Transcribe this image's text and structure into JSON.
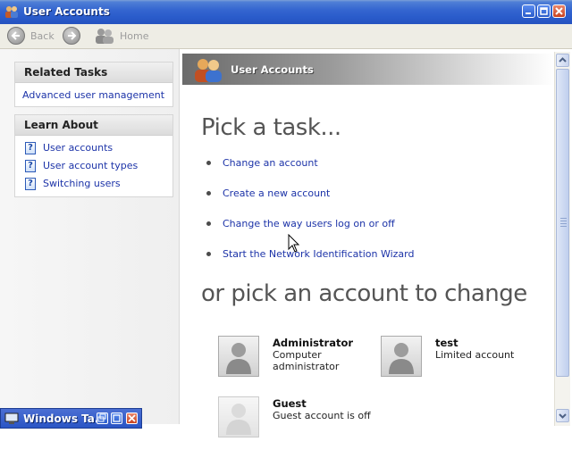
{
  "window": {
    "title": "User Accounts",
    "icon": "users-icon"
  },
  "toolbar": {
    "back_label": "Back",
    "home_label": "Home"
  },
  "sidebar": {
    "related_tasks": {
      "header": "Related Tasks",
      "items": [
        {
          "label": "Advanced user management"
        }
      ]
    },
    "learn_about": {
      "header": "Learn About",
      "items": [
        {
          "label": "User accounts",
          "icon": "help-icon"
        },
        {
          "label": "User account types",
          "icon": "help-icon"
        },
        {
          "label": "Switching users",
          "icon": "help-icon"
        }
      ]
    }
  },
  "main": {
    "header_title": "User Accounts",
    "pick_task_heading": "Pick a task...",
    "tasks": [
      {
        "label": "Change an account"
      },
      {
        "label": "Create a new account"
      },
      {
        "label": "Change the way users log on or off"
      },
      {
        "label": "Start the Network Identification Wizard"
      }
    ],
    "pick_account_heading": "or pick an account to change",
    "accounts": [
      {
        "name": "Administrator",
        "description": "Computer administrator"
      },
      {
        "name": "test",
        "description": "Limited account"
      },
      {
        "name": "Guest",
        "description": "Guest account is off"
      }
    ]
  },
  "taskbar": {
    "label": "Windows Ta..."
  }
}
